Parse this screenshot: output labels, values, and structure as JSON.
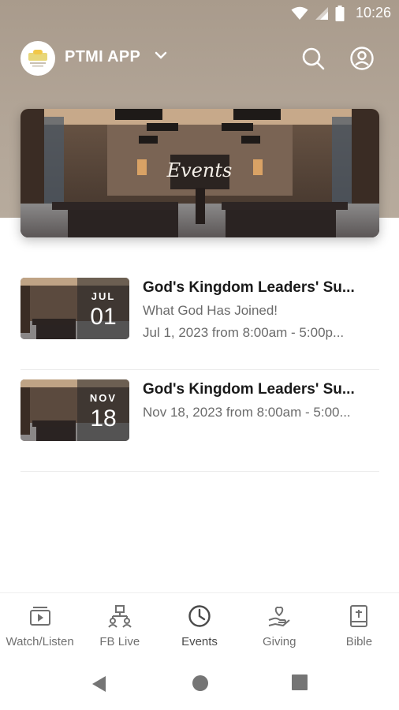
{
  "status_bar": {
    "time": "10:26",
    "icons": [
      "wifi-icon",
      "signal-icon",
      "battery-icon"
    ]
  },
  "app_bar": {
    "title": "PTMI APP",
    "logo": "ptmi-logo",
    "actions": [
      "search-icon",
      "profile-icon"
    ]
  },
  "banner": {
    "script_text": "Events"
  },
  "events": [
    {
      "title": "God's Kingdom Leaders' Su...",
      "subtitle": "What God Has Joined!",
      "time": "Jul 1, 2023 from 8:00am - 5:00p...",
      "month": "JUL",
      "day": "01"
    },
    {
      "title": "God's Kingdom Leaders' Su...",
      "subtitle": "",
      "time": "Nov 18, 2023 from 8:00am - 5:00...",
      "month": "NOV",
      "day": "18"
    }
  ],
  "bottom_nav": [
    {
      "label": "Watch/Listen",
      "icon": "play-video-icon"
    },
    {
      "label": "FB Live",
      "icon": "network-icon"
    },
    {
      "label": "Events",
      "icon": "clock-icon",
      "active": true
    },
    {
      "label": "Giving",
      "icon": "heart-hand-icon"
    },
    {
      "label": "Bible",
      "icon": "bible-icon"
    }
  ],
  "colors": {
    "header": "#b2a597",
    "active_nav": "#4a4a4a",
    "inactive_nav": "#707070"
  }
}
